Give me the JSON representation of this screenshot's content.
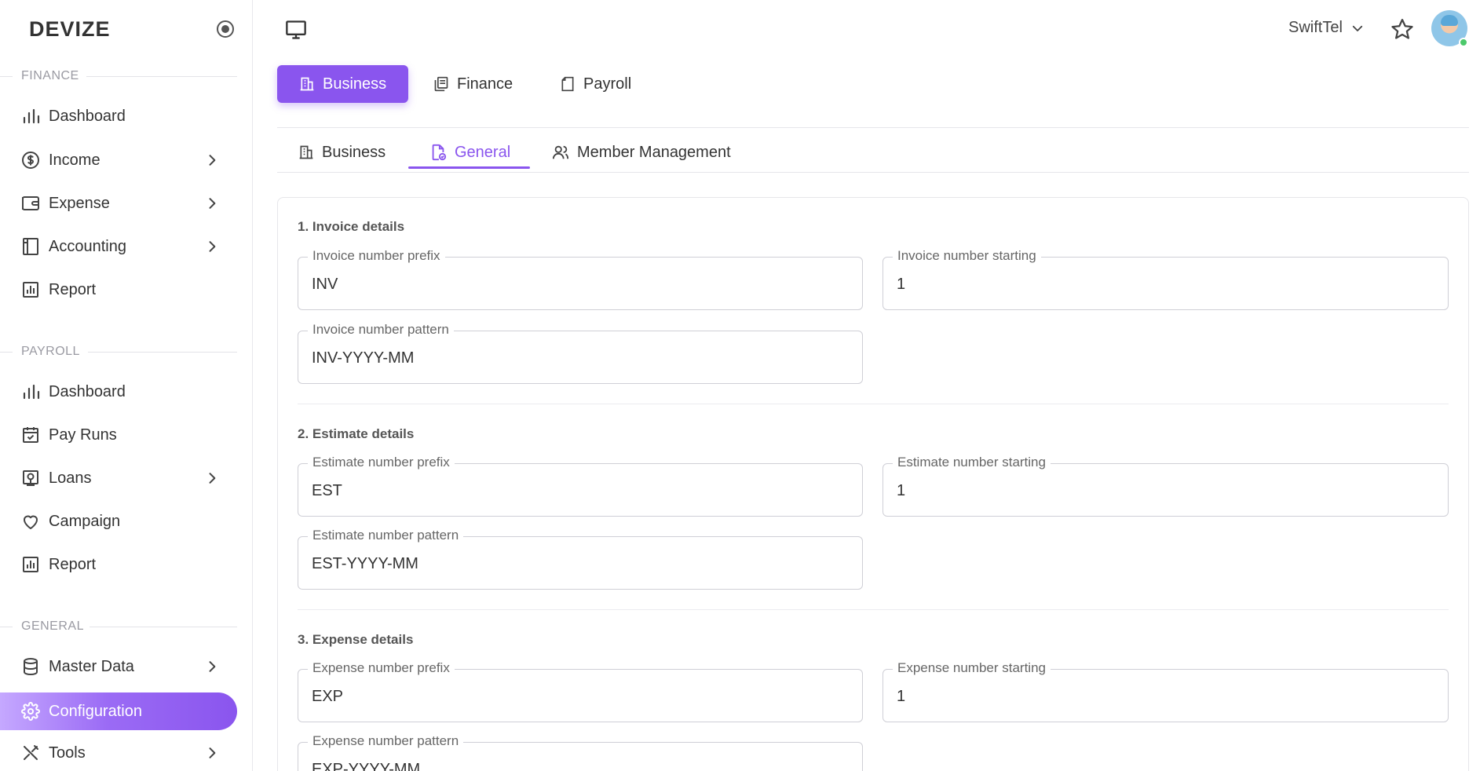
{
  "brand": "DEVIZE",
  "sidebar": {
    "sections": [
      {
        "label": "FINANCE",
        "items": [
          {
            "label": "Dashboard",
            "icon": "bar-chart-icon",
            "chevron": false
          },
          {
            "label": "Income",
            "icon": "dollar-circle-icon",
            "chevron": true
          },
          {
            "label": "Expense",
            "icon": "wallet-icon",
            "chevron": true
          },
          {
            "label": "Accounting",
            "icon": "book-icon",
            "chevron": true
          },
          {
            "label": "Report",
            "icon": "report-icon",
            "chevron": false
          }
        ]
      },
      {
        "label": "PAYROLL",
        "items": [
          {
            "label": "Dashboard",
            "icon": "bar-chart-icon",
            "chevron": false
          },
          {
            "label": "Pay Runs",
            "icon": "calendar-check-icon",
            "chevron": false
          },
          {
            "label": "Loans",
            "icon": "loan-icon",
            "chevron": true
          },
          {
            "label": "Campaign",
            "icon": "heart-icon",
            "chevron": false
          },
          {
            "label": "Report",
            "icon": "report-icon",
            "chevron": false
          }
        ]
      },
      {
        "label": "GENERAL",
        "items": [
          {
            "label": "Master Data",
            "icon": "database-icon",
            "chevron": true
          },
          {
            "label": "Configuration",
            "icon": "gear-icon",
            "chevron": false,
            "active": true
          },
          {
            "label": "Tools",
            "icon": "tools-icon",
            "chevron": true
          }
        ]
      }
    ]
  },
  "topbar": {
    "org_name": "SwiftTel",
    "status_color": "#4cc96b"
  },
  "primary_tabs": [
    {
      "label": "Business",
      "active": true
    },
    {
      "label": "Finance",
      "active": false
    },
    {
      "label": "Payroll",
      "active": false
    }
  ],
  "secondary_tabs": [
    {
      "label": "Business",
      "active": false
    },
    {
      "label": "General",
      "active": true
    },
    {
      "label": "Member Management",
      "active": false
    }
  ],
  "sections": [
    {
      "title": "1. Invoice details",
      "prefix": {
        "label": "Invoice number prefix",
        "value": "INV"
      },
      "starting": {
        "label": "Invoice number starting",
        "value": "1"
      },
      "pattern": {
        "label": "Invoice number pattern",
        "value": "INV-YYYY-MM"
      }
    },
    {
      "title": "2. Estimate details",
      "prefix": {
        "label": "Estimate number prefix",
        "value": "EST"
      },
      "starting": {
        "label": "Estimate number starting",
        "value": "1"
      },
      "pattern": {
        "label": "Estimate number pattern",
        "value": "EST-YYYY-MM"
      }
    },
    {
      "title": "3. Expense details",
      "prefix": {
        "label": "Expense number prefix",
        "value": "EXP"
      },
      "starting": {
        "label": "Expense number starting",
        "value": "1"
      },
      "pattern": {
        "label": "Expense number pattern",
        "value": "EXP-YYYY-MM"
      }
    }
  ],
  "colors": {
    "accent": "#8a55ee",
    "accent_light": "#c5a8ff"
  }
}
